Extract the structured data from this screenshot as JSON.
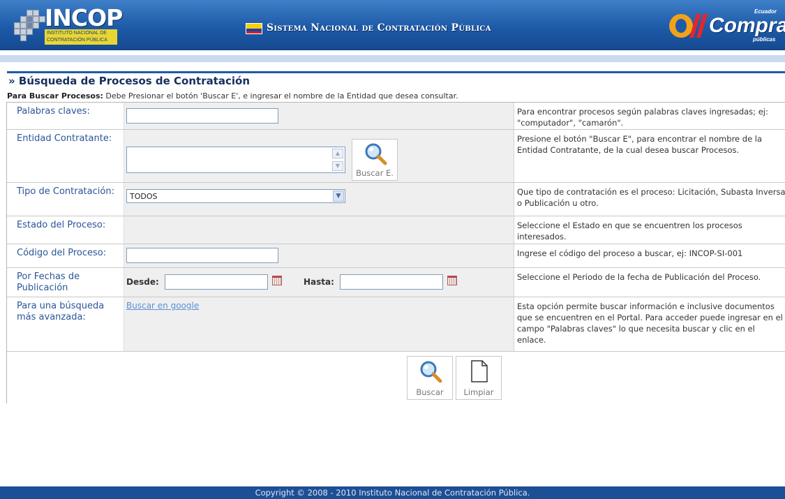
{
  "header": {
    "incop_logo_text": "INCOP",
    "incop_logo_sub": "INSTITUTO NACIONAL DE CONTRATACIÓN PÚBLICA",
    "system_title": "Sistema Nacional de Contratación Pública",
    "compras_logo_text": "Compras",
    "compras_logo_top": "Ecuador",
    "compras_logo_bottom": "públicas"
  },
  "page": {
    "title": "» Búsqueda de Procesos de Contratación",
    "instructions_bold": "Para Buscar Procesos:",
    "instructions_text": " Debe Presionar el botón 'Buscar E', e ingresar el nombre de la Entidad que desea consultar."
  },
  "form": {
    "keywords": {
      "label": "Palabras claves:",
      "value": "",
      "help": "Para encontrar procesos según palabras claves ingresadas; ej: \"computador\", \"camarón\"."
    },
    "entity": {
      "label": "Entidad Contratante:",
      "value": "",
      "button": "Buscar E.",
      "help": "Presione el botón \"Buscar E\", para encontrar el nombre de la Entidad Contratante, de la cual desea buscar Procesos."
    },
    "type": {
      "label": "Tipo de Contratación:",
      "selected": "TODOS",
      "help": "Que tipo de contratación es el proceso: Licitación, Subasta Inversa o Publicación u otro."
    },
    "status": {
      "label": "Estado del Proceso:",
      "help": "Seleccione el Estado en que se encuentren los procesos interesados."
    },
    "code": {
      "label": "Código del Proceso:",
      "value": "",
      "help": "Ingrese el código del proceso a buscar, ej: INCOP-SI-001"
    },
    "dates": {
      "label": "Por Fechas de Publicación",
      "from_label": "Desde:",
      "from_value": "",
      "to_label": "Hasta:",
      "to_value": "",
      "help": "Seleccione el Periodo de la fecha de Publicación del Proceso."
    },
    "advanced": {
      "label": "Para una búsqueda más avanzada:",
      "link": "Buscar en google",
      "help": "Esta opción permite buscar información e inclusive documentos que se encuentren en el Portal. Para acceder puede ingresar en el campo \"Palabras claves\" lo que necesita buscar y clic en el enlace."
    },
    "actions": {
      "search": "Buscar",
      "clear": "Limpiar"
    }
  },
  "footer": {
    "copyright": "Copyright © 2008 - 2010 Instituto Nacional de Contratación Pública."
  },
  "colors": {
    "header_blue": "#1d5aa8",
    "label_blue": "#2a5599",
    "link_blue": "#5a8fd6"
  }
}
